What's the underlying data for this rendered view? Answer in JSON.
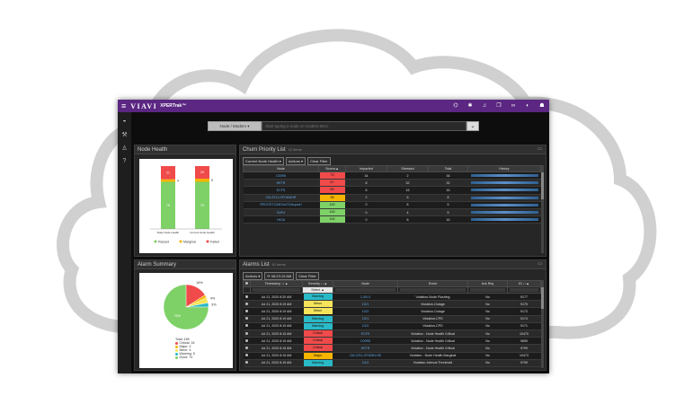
{
  "app": {
    "logo": "VIAVI",
    "product": "XPERTrak™",
    "colors": {
      "topbar": "#5b2782",
      "passed": "#7ed167",
      "marginal": "#f5b400",
      "failed": "#f04a4a",
      "warning": "#29b9c7",
      "minor": "#f5e45a",
      "major": "#f5b400",
      "critical": "#f04a4a",
      "good": "#7ed167",
      "link": "#5fa8e8"
    },
    "top_icons": [
      "sitemap-icon",
      "gear-icon",
      "bell-icon",
      "copy-icon",
      "link-icon",
      "contrast-icon",
      "user-icon"
    ],
    "nav_icons": [
      "dashboard-icon",
      "wrench-icon",
      "person-icon",
      "help-icon"
    ]
  },
  "search": {
    "selector": "Node / Modem ▾",
    "placeholder": "Start typing a node or modem MAC"
  },
  "node_health": {
    "title": "Node Health",
    "chart_data": {
      "type": "bar",
      "categories": [
        "Daily Node Health",
        "Current Node Health"
      ],
      "series": [
        {
          "name": "Passed",
          "values": [
            75,
            75
          ]
        },
        {
          "name": "Marginal",
          "values": [
            4,
            5
          ]
        },
        {
          "name": "Failed",
          "values": [
            21,
            20
          ]
        }
      ],
      "data_labels": [
        [
          "75",
          "4",
          "21"
        ],
        [
          "75",
          "5",
          "20"
        ]
      ]
    },
    "legend": [
      "Passed",
      "Marginal",
      "Failed"
    ]
  },
  "alarm_summary": {
    "title": "Alarm Summary",
    "chart_data": {
      "type": "pie",
      "labels": [
        "Critical",
        "Major",
        "Minor",
        "Warning",
        "Good"
      ],
      "values": [
        16,
        2,
        4,
        3,
        75
      ],
      "slice_labels": [
        "16%",
        "",
        "4%",
        "3%",
        "75%"
      ]
    },
    "total_label": "Total: 165",
    "legend": [
      "Critical: 16",
      "Major: 2",
      "Minor: 4",
      "Warning: 5",
      "Good: 74"
    ]
  },
  "churn": {
    "title": "Churn Priority List",
    "count": "12 items",
    "buttons": [
      "Current Node Health ▾",
      "Actions ▾",
      "Clear Filter"
    ],
    "columns": [
      "Node",
      "Scores▲",
      "Impacted",
      "Stressed",
      "Total",
      "History"
    ],
    "rows": [
      {
        "node": "C00R5",
        "score": "79",
        "impacted": "34",
        "stressed": "2",
        "total": "36",
        "level": "failed"
      },
      {
        "node": "HETR",
        "score": "87",
        "impacted": "8",
        "stressed": "32",
        "total": "32",
        "level": "failed"
      },
      {
        "node": "ECFS",
        "score": "89",
        "impacted": "8",
        "stressed": "16",
        "total": "16",
        "level": "failed"
      },
      {
        "node": "CM-2211-OFDMUHR",
        "score": "95",
        "impacted": "2",
        "stressed": "6",
        "total": "8",
        "level": "marginal"
      },
      {
        "node": "RPD/TETC/MIS/xZ70/supwH",
        "score": "100",
        "impacted": "0",
        "stressed": "8",
        "total": "5",
        "level": "passed"
      },
      {
        "node": "D0P4",
        "score": "100",
        "impacted": "0",
        "stressed": "4",
        "total": "5",
        "level": "passed"
      },
      {
        "node": "HK16",
        "score": "100",
        "impacted": "0",
        "stressed": "8",
        "total": "16",
        "level": "passed"
      }
    ]
  },
  "alarms": {
    "title": "Alarms List",
    "count": "61 items",
    "buttons": [
      "Actions ▾",
      "Clear Filter"
    ],
    "refresh": "08:23:19 AM",
    "columns": [
      "",
      "Timestamp ↓↑▲",
      "Severity ↓↑▲",
      "Node",
      "Event",
      "Ack Req",
      "ID ↓↑▲"
    ],
    "severity_filter": "Select ▲",
    "rows": [
      {
        "time": "Jul 21, 2020 8:20 AM",
        "severity": "Warning",
        "node": "1.4/0.0",
        "event": "Violation-Node Flushing",
        "ack": "No",
        "id": "9177"
      },
      {
        "time": "Jul 21, 2020 8:19 AM",
        "severity": "Minor",
        "node": "1G/1",
        "event": "Violation-Outage",
        "ack": "No",
        "id": "9175"
      },
      {
        "time": "Jul 21, 2020 8:19 AM",
        "severity": "Minor",
        "node": "1G/2",
        "event": "Violation-Outage",
        "ack": "No",
        "id": "9173"
      },
      {
        "time": "Jul 21, 2020 8:19 AM",
        "severity": "Warning",
        "node": "1G/1",
        "event": "Violation-CPD",
        "ack": "No",
        "id": "9174"
      },
      {
        "time": "Jul 21, 2020 8:19 AM",
        "severity": "Warning",
        "node": "1G/2",
        "event": "Violation-CPD",
        "ack": "No",
        "id": "9171"
      },
      {
        "time": "Jul 21, 2020 8:15 AM",
        "severity": "Critical",
        "node": "ECFS",
        "event": "Violation - Node Health Critical",
        "ack": "No",
        "id": "10470"
      },
      {
        "time": "Jul 21, 2020 8:15 AM",
        "severity": "Critical",
        "node": "C00R5",
        "event": "Violation - Node Health Critical",
        "ack": "No",
        "id": "9895"
      },
      {
        "time": "Jul 21, 2020 8:15 AM",
        "severity": "Critical",
        "node": "HETR",
        "event": "Violation - Node Health Critical",
        "ack": "No",
        "id": "9799"
      },
      {
        "time": "Jul 21, 2020 8:15 AM",
        "severity": "Major",
        "node": "CM-2211-OFDMN-HE",
        "event": "Violation - Node Health Marginal",
        "ack": "No",
        "id": "10473"
      },
      {
        "time": "Jul 21, 2020 8:15 AM",
        "severity": "Warning",
        "node": "1G/2",
        "event": "Violation-Interval Threshold",
        "ack": "No",
        "id": "9799"
      }
    ]
  }
}
